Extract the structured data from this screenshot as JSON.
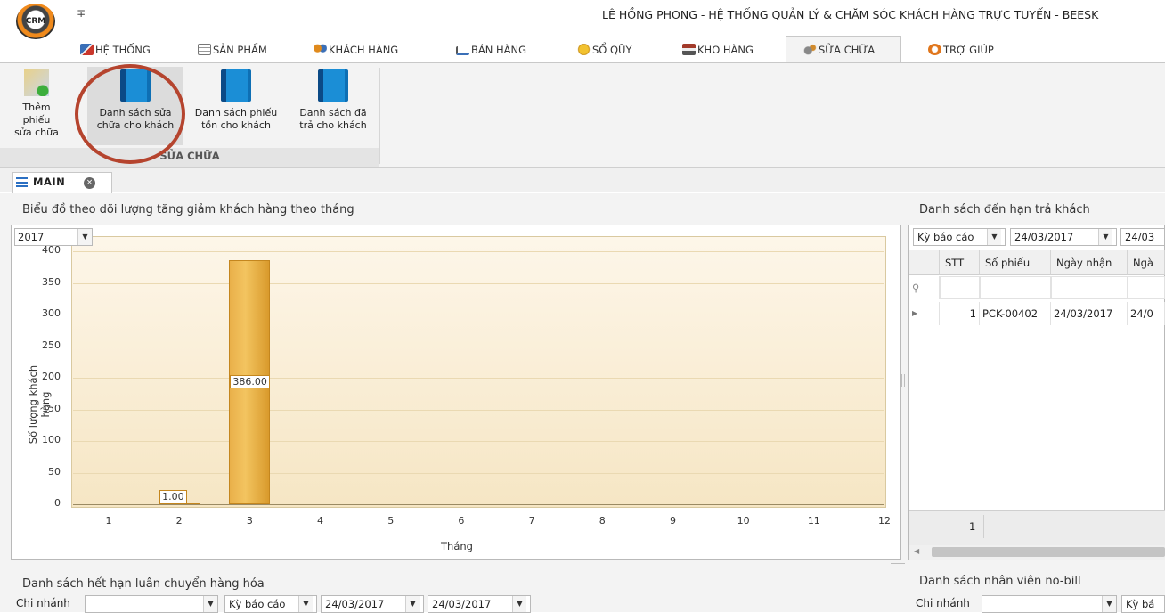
{
  "app": {
    "logo_text": "CRM",
    "quick_access": "∓",
    "title": "LÊ HỒNG PHONG - HỆ THỐNG QUẢN LÝ & CHĂM SÓC KHÁCH HÀNG TRỰC TUYẾN - BEESK"
  },
  "menu_tabs": [
    {
      "label": "HỆ THỐNG",
      "icon": "tools-icon",
      "color": "#3a6fb7"
    },
    {
      "label": "SẢN PHẨM",
      "icon": "table-icon",
      "color": "#777777"
    },
    {
      "label": "KHÁCH HÀNG",
      "icon": "users-icon",
      "color": "#e08a1c"
    },
    {
      "label": "BÁN HÀNG",
      "icon": "cart-icon",
      "color": "#3a6fb7"
    },
    {
      "label": "SỔ QŨY",
      "icon": "coins-icon",
      "color": "#d9a520"
    },
    {
      "label": "KHO HÀNG",
      "icon": "store-icon",
      "color": "#a23a2a"
    },
    {
      "label": "SỬA CHỮA",
      "icon": "gears-icon",
      "color": "#888888"
    },
    {
      "label": "TRỢ GIÚP",
      "icon": "help-icon",
      "color": "#e0761c"
    }
  ],
  "ribbon": {
    "group_label": "SỬA CHỮA",
    "buttons": [
      {
        "line1": "Thêm phiếu",
        "line2": "sửa chữa"
      },
      {
        "line1": "Danh sách sửa",
        "line2": "chữa cho khách"
      },
      {
        "line1": "Danh sách phiếu",
        "line2": "tồn cho khách"
      },
      {
        "line1": "Danh sách đã",
        "line2": "trả cho khách"
      }
    ]
  },
  "doc_tab": {
    "label": "MAIN"
  },
  "chart_panel": {
    "title": "Biểu đồ theo dõi lượng tăng giảm khách hàng theo tháng",
    "year": "2017"
  },
  "chart_data": {
    "type": "bar",
    "categories": [
      "1",
      "2",
      "3",
      "4",
      "5",
      "6",
      "7",
      "8",
      "9",
      "10",
      "11",
      "12"
    ],
    "values": [
      0,
      1,
      386,
      0,
      0,
      0,
      0,
      0,
      0,
      0,
      0,
      0
    ],
    "data_labels": {
      "2": "1.00",
      "3": "386.00"
    },
    "xlabel": "Tháng",
    "ylabel": "Số lượng khách hàng",
    "ylim": [
      0,
      400
    ],
    "yticks": [
      "0",
      "50",
      "100",
      "150",
      "200",
      "250",
      "300",
      "350",
      "400"
    ],
    "grid": true,
    "colors": {
      "bar": "#f0b84e",
      "plot_bg": "#f8ebcf"
    }
  },
  "right_panel": {
    "title": "Danh sách đến hạn trả khách",
    "period_label": "Kỳ báo cáo",
    "date_from": "24/03/2017",
    "date_to": "24/03",
    "columns": [
      "STT",
      "Số phiếu",
      "Ngày nhận",
      "Ngà"
    ],
    "rows": [
      {
        "stt": "1",
        "so_phieu": "PCK-00402",
        "ngay_nhan": "24/03/2017",
        "ngay": "24/0"
      }
    ],
    "footer_count": "1"
  },
  "bottom_left": {
    "title": "Danh sách hết hạn luân chuyển hàng hóa",
    "branch_label": "Chi nhánh",
    "period_label": "Kỳ báo cáo",
    "date_from": "24/03/2017",
    "date_to": "24/03/2017"
  },
  "bottom_right": {
    "title": "Danh sách nhân viên no-bill",
    "branch_label": "Chi nhánh",
    "period_label": "Kỳ bá"
  }
}
